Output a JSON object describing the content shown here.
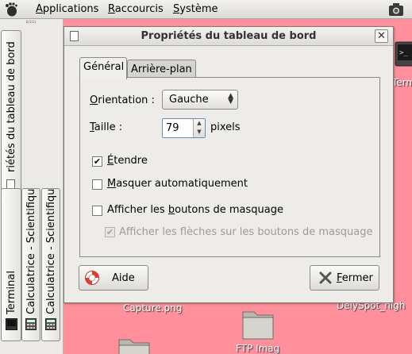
{
  "top_panel": {
    "menus": [
      {
        "label": "Applications",
        "mnemonic": "A",
        "rest": "pplications"
      },
      {
        "label": "Raccourcis",
        "mnemonic": "R",
        "rest": "accourcis"
      },
      {
        "label": "Système",
        "mnemonic": "S",
        "rest": "ystème"
      }
    ]
  },
  "left_panel": {
    "buttons": [
      {
        "label": "riétés du tableau de bord"
      },
      {
        "label": "Terminal"
      },
      {
        "label": "Calculatrice - Scientifique"
      },
      {
        "label": "Calculatrice - Scientifique"
      }
    ]
  },
  "desktop": {
    "icons": [
      {
        "label": "Termi"
      },
      {
        "label": "Capture.png"
      },
      {
        "label": "DeiySpot_nigh"
      },
      {
        "label": "FTP Imag"
      }
    ]
  },
  "dialog": {
    "title": "Propriétés du tableau de bord",
    "tabs": [
      {
        "label": "Général"
      },
      {
        "label": "Arrière-plan"
      }
    ],
    "orientation": {
      "label_u": "O",
      "label_rest": "rientation :",
      "value": "Gauche"
    },
    "size": {
      "label_u": "T",
      "label_rest": "aille :",
      "value": "79",
      "unit": "pixels"
    },
    "expand": {
      "label_pre": "",
      "label_u": "É",
      "label_rest": "tendre",
      "checked": true
    },
    "autohide": {
      "label_pre": "",
      "label_u": "M",
      "label_rest": "asquer automatiquement",
      "checked": false
    },
    "hide_buttons": {
      "label_pre": "Afficher les ",
      "label_u": "b",
      "label_rest": "outons de masquage",
      "checked": false
    },
    "arrows": {
      "label": "Afficher les flèches sur les boutons de masquage",
      "checked": true,
      "disabled": true
    },
    "help_button": {
      "label_pre": "Aide",
      "label_u": "",
      "label_rest": ""
    },
    "close_button": {
      "label_u": "F",
      "label_rest": "ermer"
    }
  },
  "colors": {
    "desktop": "#ff8f9a",
    "dialog_bg": "#eeece8",
    "panel_bg": "#eceae6"
  }
}
